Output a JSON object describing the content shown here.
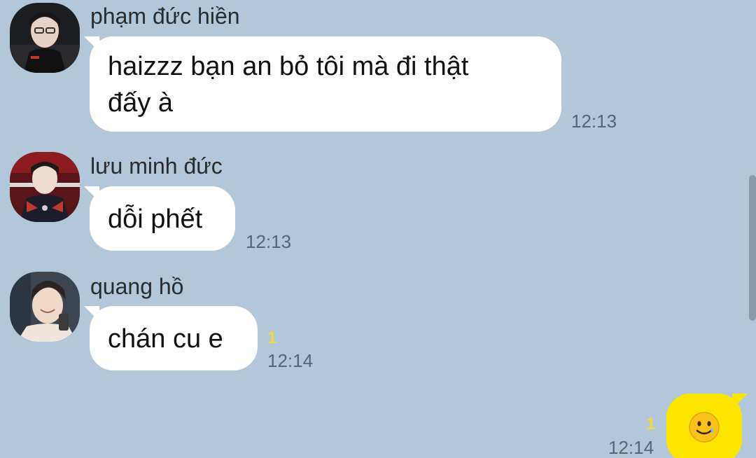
{
  "messages": [
    {
      "sender": "phạm đức hiền",
      "lines": [
        "haizzz bạn an bỏ tôi mà đi thật",
        "đấy à"
      ],
      "time": "12:13"
    },
    {
      "sender": "lưu minh đức",
      "lines": [
        "dỗi phết"
      ],
      "time": "12:13"
    },
    {
      "sender": "quang hồ",
      "lines": [
        "chán cu e"
      ],
      "time": "12:14",
      "unread": "1"
    }
  ],
  "my_message": {
    "icon": "smiling-face-with-tear-emoji",
    "time": "12:14",
    "unread": "1"
  },
  "colors": {
    "background": "#b2c7d9",
    "incoming_bubble": "#ffffff",
    "outgoing_bubble": "#fee500",
    "unread_count": "#f2d83b"
  }
}
